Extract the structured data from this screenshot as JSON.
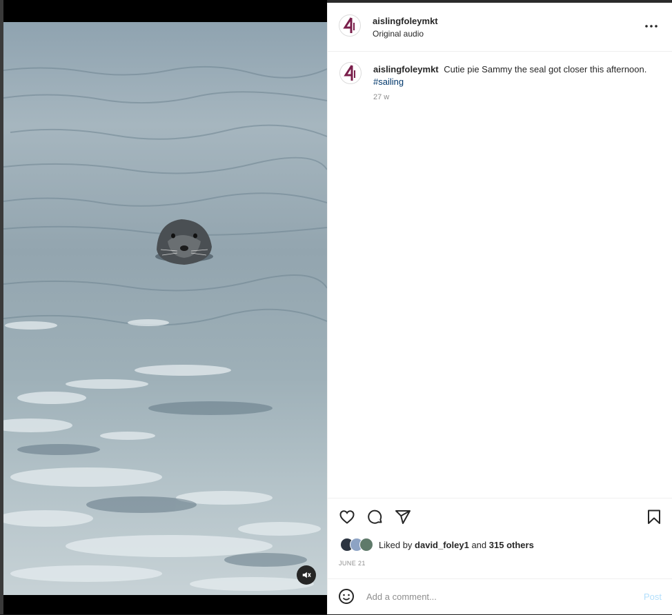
{
  "post": {
    "author": "aislingfoleymkt",
    "audio_label": "Original audio",
    "caption": {
      "username": "aislingfoleymkt",
      "text": "Cutie pie Sammy the seal got closer this afternoon.",
      "hashtag": "#sailing",
      "age": "27 w"
    },
    "likes": {
      "prefix": "Liked by",
      "first_user": "david_foley1",
      "conjunction": "and",
      "others": "315 others"
    },
    "date": "JUNE 21"
  },
  "comment": {
    "placeholder": "Add a comment...",
    "post_label": "Post"
  },
  "icons": {
    "more": "more-options-icon",
    "like": "heart-icon",
    "comment": "comment-bubble-icon",
    "share": "paper-plane-icon",
    "save": "bookmark-icon",
    "emoji": "emoji-icon",
    "mute": "muted-speaker-icon"
  },
  "colors": {
    "brand_avatar": "#7a1f4b",
    "hashtag": "#00376b",
    "post_button_disabled": "#b2dffc",
    "secondary_text": "#8e8e8e"
  }
}
